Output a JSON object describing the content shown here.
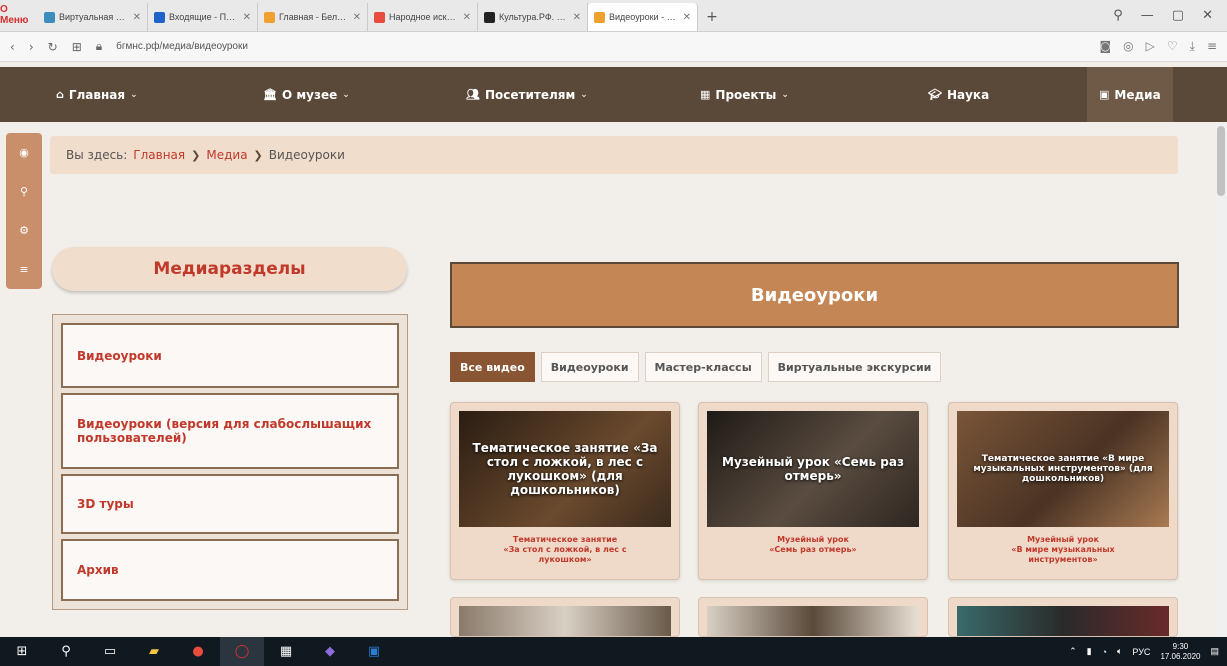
{
  "browser": {
    "logo": "O Меню",
    "tabs": [
      {
        "title": "Виртуальная школа",
        "color": "#3c8dbc",
        "active": false
      },
      {
        "title": "Входящие - Почта Mail.ru",
        "color": "#1e63c9",
        "active": false
      },
      {
        "title": "Главная - Белгородский",
        "color": "#f0a030",
        "active": false
      },
      {
        "title": "Народное искусство",
        "color": "#e74c3c",
        "active": false
      },
      {
        "title": "Культура.РФ. Портал",
        "color": "#222222",
        "active": false
      },
      {
        "title": "Видеоуроки - Белгородский",
        "color": "#f0a030",
        "active": true
      }
    ],
    "url": "бгмнс.рф/медиа/видеоуроки"
  },
  "nav": {
    "items": [
      {
        "label": "Главная",
        "icon": "home-icon",
        "dropdown": true
      },
      {
        "label": "О музее",
        "icon": "museum-icon",
        "dropdown": true
      },
      {
        "label": "Посетителям",
        "icon": "users-icon",
        "dropdown": true
      },
      {
        "label": "Проекты",
        "icon": "grid-icon",
        "dropdown": true
      },
      {
        "label": "Наука",
        "icon": "graduation-icon",
        "dropdown": false
      },
      {
        "label": "Медиа",
        "icon": "media-icon",
        "dropdown": false,
        "active": true
      }
    ]
  },
  "breadcrumb": {
    "prefix": "Вы здесь:",
    "items": [
      "Главная",
      "Медиа",
      "Видеоуроки"
    ]
  },
  "sidebar": {
    "title": "Медиаразделы",
    "items": [
      "Видеоуроки",
      "Видеоуроки (версия для слабослышащих пользователей)",
      "3D туры",
      "Архив"
    ]
  },
  "main": {
    "title": "Видеоуроки",
    "filters": [
      "Все видео",
      "Видеоуроки",
      "Мастер-классы",
      "Виртуальные экскурсии"
    ],
    "active_filter": "Все видео",
    "cards": [
      {
        "thumb_text": "Тематическое занятие «За стол с ложкой, в лес с лукошком» (для дошкольников)",
        "caption": "Тематическое занятие\n«За стол с ложкой, в лес с\nлукошком»",
        "bg": "#3a2a1c"
      },
      {
        "thumb_text": "Музейный урок «Семь раз отмерь»",
        "caption": "Музейный урок\n«Семь раз отмерь»",
        "bg": "#2e2620"
      },
      {
        "thumb_text": "Тематическое занятие «В мире музыкальных инструментов» (для дошкольников)",
        "caption": "Музейный урок\n«В мире музыкальных\nинструментов»",
        "bg": "#4a3324"
      }
    ]
  },
  "taskbar": {
    "lang": "РУС",
    "time": "9:30",
    "date": "17.06.2020"
  }
}
